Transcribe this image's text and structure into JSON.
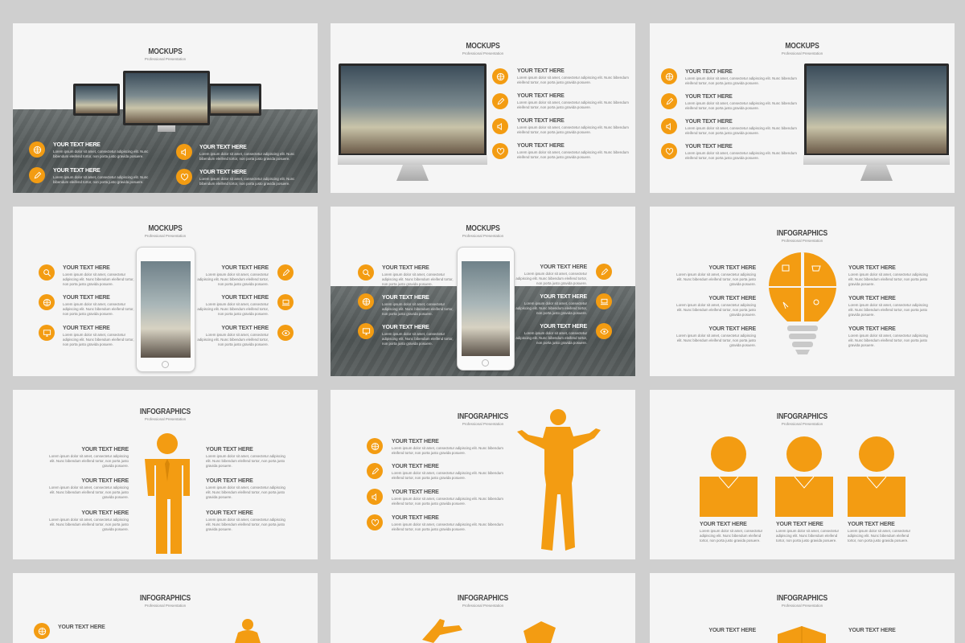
{
  "colors": {
    "accent": "#f39c12",
    "background": "#cfcfcf",
    "slide": "#f5f5f5"
  },
  "slides": {
    "s1": {
      "title": "MOCKUPS",
      "sub": "Professional Presentation",
      "items": [
        {
          "h": "YOUR TEXT HERE",
          "p": "Lorem ipsum dolor sit amet, consectetur adipiscing elit. Nunc bibendum eleifend tortor, non porta justo gravida posuere.",
          "icon": "globe-icon"
        },
        {
          "h": "YOUR TEXT HERE",
          "p": "Lorem ipsum dolor sit amet, consectetur adipiscing elit. Nunc bibendum eleifend tortor, non porta justo gravida posuere.",
          "icon": "pencil-icon"
        },
        {
          "h": "YOUR TEXT HERE",
          "p": "Lorem ipsum dolor sit amet, consectetur adipiscing elit. Nunc bibendum eleifend tortor, non porta justo gravida posuere.",
          "icon": "speaker-icon"
        },
        {
          "h": "YOUR TEXT HERE",
          "p": "Lorem ipsum dolor sit amet, consectetur adipiscing elit. Nunc bibendum eleifend tortor, non porta justo gravida posuere.",
          "icon": "heart-icon"
        }
      ]
    },
    "s2": {
      "title": "MOCKUPS",
      "sub": "Professional Presentation",
      "items": [
        {
          "h": "YOUR TEXT HERE",
          "p": "Lorem ipsum dolor sit amet, consectetur adipiscing elit. Nunc bibendum eleifend tortor, non porta justo gravida posuere."
        },
        {
          "h": "YOUR TEXT HERE",
          "p": "Lorem ipsum dolor sit amet, consectetur adipiscing elit. Nunc bibendum eleifend tortor, non porta justo gravida posuere."
        },
        {
          "h": "YOUR TEXT HERE",
          "p": "Lorem ipsum dolor sit amet, consectetur adipiscing elit. Nunc bibendum eleifend tortor, non porta justo gravida posuere."
        },
        {
          "h": "YOUR TEXT HERE",
          "p": "Lorem ipsum dolor sit amet, consectetur adipiscing elit. Nunc bibendum eleifend tortor, non porta justo gravida posuere."
        }
      ]
    },
    "s3": {
      "title": "MOCKUPS",
      "sub": "Professional Presentation",
      "items": [
        {
          "h": "YOUR TEXT HERE",
          "p": "Lorem ipsum dolor sit amet, consectetur adipiscing elit. Nunc bibendum eleifend tortor, non porta justo gravida posuere."
        },
        {
          "h": "YOUR TEXT HERE",
          "p": "Lorem ipsum dolor sit amet, consectetur adipiscing elit. Nunc bibendum eleifend tortor, non porta justo gravida posuere."
        },
        {
          "h": "YOUR TEXT HERE",
          "p": "Lorem ipsum dolor sit amet, consectetur adipiscing elit. Nunc bibendum eleifend tortor, non porta justo gravida posuere."
        },
        {
          "h": "YOUR TEXT HERE",
          "p": "Lorem ipsum dolor sit amet, consectetur adipiscing elit. Nunc bibendum eleifend tortor, non porta justo gravida posuere."
        }
      ]
    },
    "s4": {
      "title": "MOCKUPS",
      "sub": "Professional Presentation",
      "items": [
        {
          "h": "YOUR TEXT HERE",
          "p": "Lorem ipsum dolor sit amet, consectetur adipiscing elit. Nunc bibendum eleifend tortor, non porta justo gravida posuere."
        },
        {
          "h": "YOUR TEXT HERE",
          "p": "Lorem ipsum dolor sit amet, consectetur adipiscing elit. Nunc bibendum eleifend tortor, non porta justo gravida posuere."
        },
        {
          "h": "YOUR TEXT HERE",
          "p": "Lorem ipsum dolor sit amet, consectetur adipiscing elit. Nunc bibendum eleifend tortor, non porta justo gravida posuere."
        },
        {
          "h": "YOUR TEXT HERE",
          "p": "Lorem ipsum dolor sit amet, consectetur adipiscing elit. Nunc bibendum eleifend tortor, non porta justo gravida posuere."
        },
        {
          "h": "YOUR TEXT HERE",
          "p": "Lorem ipsum dolor sit amet, consectetur adipiscing elit. Nunc bibendum eleifend tortor, non porta justo gravida posuere."
        },
        {
          "h": "YOUR TEXT HERE",
          "p": "Lorem ipsum dolor sit amet, consectetur adipiscing elit. Nunc bibendum eleifend tortor, non porta justo gravida posuere."
        }
      ]
    },
    "s5": {
      "title": "MOCKUPS",
      "sub": "Professional Presentation",
      "items": [
        {
          "h": "YOUR TEXT HERE",
          "p": "Lorem ipsum dolor sit amet, consectetur adipiscing elit. Nunc bibendum eleifend tortor, non porta justo gravida posuere."
        },
        {
          "h": "YOUR TEXT HERE",
          "p": "Lorem ipsum dolor sit amet, consectetur adipiscing elit. Nunc bibendum eleifend tortor, non porta justo gravida posuere."
        },
        {
          "h": "YOUR TEXT HERE",
          "p": "Lorem ipsum dolor sit amet, consectetur adipiscing elit. Nunc bibendum eleifend tortor, non porta justo gravida posuere."
        },
        {
          "h": "YOUR TEXT HERE",
          "p": "Lorem ipsum dolor sit amet, consectetur adipiscing elit. Nunc bibendum eleifend tortor, non porta justo gravida posuere."
        },
        {
          "h": "YOUR TEXT HERE",
          "p": "Lorem ipsum dolor sit amet, consectetur adipiscing elit. Nunc bibendum eleifend tortor, non porta justo gravida posuere."
        },
        {
          "h": "YOUR TEXT HERE",
          "p": "Lorem ipsum dolor sit amet, consectetur adipiscing elit. Nunc bibendum eleifend tortor, non porta justo gravida posuere."
        }
      ]
    },
    "s6": {
      "title": "INFOGRAPHICS",
      "sub": "Professional Presentation",
      "items": [
        {
          "h": "YOUR TEXT HERE",
          "p": "Lorem ipsum dolor sit amet, consectetur adipiscing elit. Nunc bibendum eleifend tortor, non porta justo gravida posuere."
        },
        {
          "h": "YOUR TEXT HERE",
          "p": "Lorem ipsum dolor sit amet, consectetur adipiscing elit. Nunc bibendum eleifend tortor, non porta justo gravida posuere."
        },
        {
          "h": "YOUR TEXT HERE",
          "p": "Lorem ipsum dolor sit amet, consectetur adipiscing elit. Nunc bibendum eleifend tortor, non porta justo gravida posuere."
        },
        {
          "h": "YOUR TEXT HERE",
          "p": "Lorem ipsum dolor sit amet, consectetur adipiscing elit. Nunc bibendum eleifend tortor, non porta justo gravida posuere."
        },
        {
          "h": "YOUR TEXT HERE",
          "p": "Lorem ipsum dolor sit amet, consectetur adipiscing elit. Nunc bibendum eleifend tortor, non porta justo gravida posuere."
        },
        {
          "h": "YOUR TEXT HERE",
          "p": "Lorem ipsum dolor sit amet, consectetur adipiscing elit. Nunc bibendum eleifend tortor, non porta justo gravida posuere."
        }
      ]
    },
    "s7": {
      "title": "INFOGRAPHICS",
      "sub": "Professional Presentation",
      "items": [
        {
          "h": "YOUR TEXT HERE",
          "p": "Lorem ipsum dolor sit amet, consectetur adipiscing elit. Nunc bibendum eleifend tortor, non porta justo gravida posuere."
        },
        {
          "h": "YOUR TEXT HERE",
          "p": "Lorem ipsum dolor sit amet, consectetur adipiscing elit. Nunc bibendum eleifend tortor, non porta justo gravida posuere."
        },
        {
          "h": "YOUR TEXT HERE",
          "p": "Lorem ipsum dolor sit amet, consectetur adipiscing elit. Nunc bibendum eleifend tortor, non porta justo gravida posuere."
        },
        {
          "h": "YOUR TEXT HERE",
          "p": "Lorem ipsum dolor sit amet, consectetur adipiscing elit. Nunc bibendum eleifend tortor, non porta justo gravida posuere."
        },
        {
          "h": "YOUR TEXT HERE",
          "p": "Lorem ipsum dolor sit amet, consectetur adipiscing elit. Nunc bibendum eleifend tortor, non porta justo gravida posuere."
        },
        {
          "h": "YOUR TEXT HERE",
          "p": "Lorem ipsum dolor sit amet, consectetur adipiscing elit. Nunc bibendum eleifend tortor, non porta justo gravida posuere."
        }
      ]
    },
    "s8": {
      "title": "INFOGRAPHICS",
      "sub": "Professional Presentation",
      "items": [
        {
          "h": "YOUR TEXT HERE",
          "p": "Lorem ipsum dolor sit amet, consectetur adipiscing elit. Nunc bibendum eleifend tortor, non porta justo gravida posuere."
        },
        {
          "h": "YOUR TEXT HERE",
          "p": "Lorem ipsum dolor sit amet, consectetur adipiscing elit. Nunc bibendum eleifend tortor, non porta justo gravida posuere."
        },
        {
          "h": "YOUR TEXT HERE",
          "p": "Lorem ipsum dolor sit amet, consectetur adipiscing elit. Nunc bibendum eleifend tortor, non porta justo gravida posuere."
        },
        {
          "h": "YOUR TEXT HERE",
          "p": "Lorem ipsum dolor sit amet, consectetur adipiscing elit. Nunc bibendum eleifend tortor, non porta justo gravida posuere."
        }
      ]
    },
    "s9": {
      "title": "INFOGRAPHICS",
      "sub": "Professional Presentation",
      "items": [
        {
          "h": "YOUR TEXT HERE",
          "p": "Lorem ipsum dolor sit amet, consectetur adipiscing elit. Nunc bibendum eleifend tortor, non porta justo gravida posuere."
        },
        {
          "h": "YOUR TEXT HERE",
          "p": "Lorem ipsum dolor sit amet, consectetur adipiscing elit. Nunc bibendum eleifend tortor, non porta justo gravida posuere."
        },
        {
          "h": "YOUR TEXT HERE",
          "p": "Lorem ipsum dolor sit amet, consectetur adipiscing elit. Nunc bibendum eleifend tortor, non porta justo gravida posuere."
        }
      ]
    },
    "s10": {
      "title": "INFOGRAPHICS",
      "sub": "Professional Presentation",
      "items": [
        {
          "h": "YOUR TEXT HERE"
        }
      ]
    },
    "s11": {
      "title": "INFOGRAPHICS",
      "sub": "Professional Presentation"
    },
    "s12": {
      "title": "INFOGRAPHICS",
      "sub": "Professional Presentation",
      "items": [
        {
          "h": "YOUR TEXT HERE"
        },
        {
          "h": "YOUR TEXT HERE"
        }
      ]
    }
  }
}
